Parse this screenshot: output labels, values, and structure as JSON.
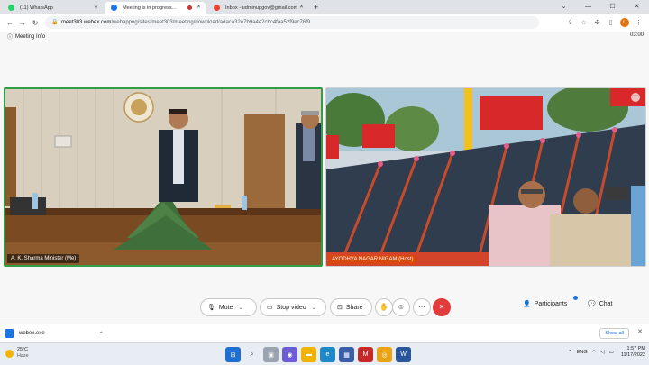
{
  "browser": {
    "tabs": [
      {
        "title": "(11) WhatsApp",
        "fav_color": "#25d366",
        "active": false,
        "recording": false
      },
      {
        "title": "Meeting is in progress...",
        "fav_color": "#1a73e8",
        "active": true,
        "recording": true
      },
      {
        "title": "Inbox - udminupgov@gmail.com",
        "fav_color": "#ea4335",
        "active": false,
        "recording": false
      }
    ],
    "url_host": "meet303.webex.com",
    "url_path": "/webappng/sites/meet303/meeting/download/adaca32e7b9a4e2cbc4faa52f9ec76f9"
  },
  "meeting": {
    "info_label": "Meeting Info",
    "timer": "03:00",
    "participants_video": [
      {
        "name": "A. K. Sharma Minister (Me)"
      },
      {
        "name": "AYODHYA NAGAR NIGAM (Host)"
      }
    ],
    "controls": {
      "mute": "Mute",
      "stop_video": "Stop video",
      "share": "Share",
      "participants": "Participants",
      "chat": "Chat"
    }
  },
  "downloads": {
    "file_name": "webex.exe",
    "show_all": "Show all"
  },
  "taskbar": {
    "temperature": "25°C",
    "condition": "Haze",
    "language": "ENG",
    "time": "1:57 PM",
    "date": "11/17/2022"
  },
  "colors": {
    "active_speaker_border": "#2f9e44",
    "end_call": "#e23b3b",
    "host_label_bg": "#d9480f"
  }
}
